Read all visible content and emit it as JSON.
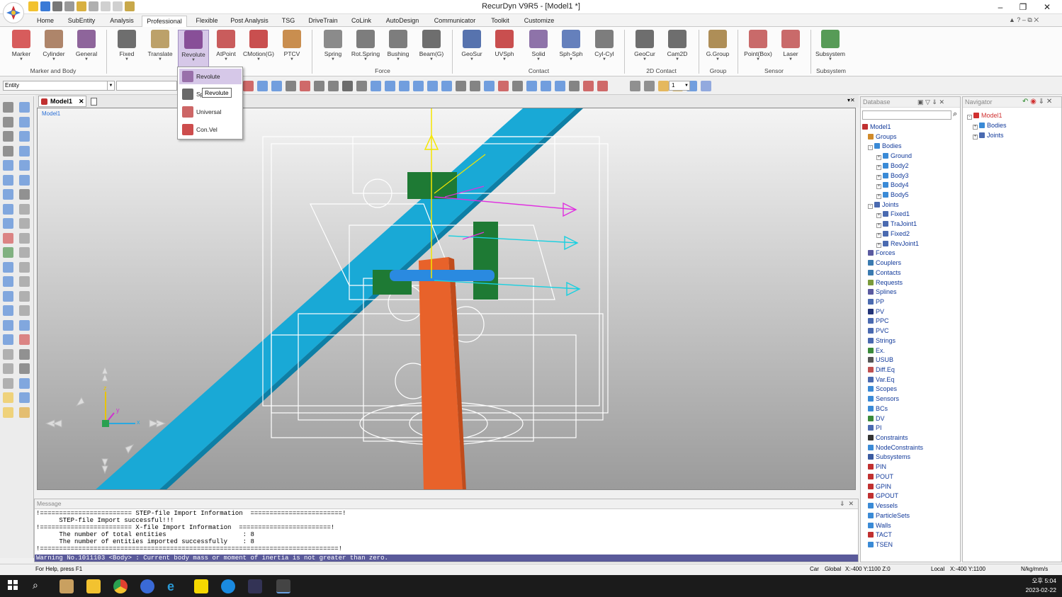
{
  "window": {
    "title": "RecurDyn V9R5  - [Model1 *]"
  },
  "tabs": [
    "Home",
    "SubEntity",
    "Analysis",
    "Professional",
    "Flexible",
    "Post Analysis",
    "TSG",
    "DriveTrain",
    "CoLink",
    "AutoDesign",
    "Communicator",
    "Toolkit",
    "Customize"
  ],
  "active_tab": "Professional",
  "ribbon": {
    "buttons": [
      "Marker",
      "Cylinder",
      "General",
      "Fixed",
      "Translate",
      "Revolute",
      "AtPoint",
      "CMotion(G)",
      "PTCV",
      "Spring",
      "Rot.Spring",
      "Bushing",
      "Beam(G)",
      "GeoSur",
      "UVSph",
      "Solid",
      "Sph-Sph",
      "Cyl-Cyl",
      "GeoCur",
      "Cam2D",
      "G.Group",
      "Point(Box)",
      "Laser",
      "Subsystem"
    ],
    "groups": [
      "Marker and Body",
      "Force",
      "Contact",
      "2D Contact",
      "Group",
      "Sensor",
      "Subsystem"
    ]
  },
  "entity_combo": "Entity",
  "toolbar_number": "1",
  "document_tab": "Model1",
  "viewport_label": "Model1",
  "axis_labels": {
    "z": "z",
    "y": "y",
    "x": "x"
  },
  "revolute_dropdown": {
    "items": [
      "Revolute",
      "Sp",
      "Universal",
      "Con.Vel"
    ],
    "tooltip": "Revolute"
  },
  "database": {
    "title": "Database",
    "tree": [
      {
        "label": "Model1",
        "level": 0,
        "color": "#c03030"
      },
      {
        "label": "Groups",
        "level": 1,
        "color": "#d08a2a"
      },
      {
        "label": "Bodies",
        "level": 1,
        "color": "#3a8ad6",
        "exp": "-"
      },
      {
        "label": "Ground",
        "level": 2,
        "color": "#3a8ad6",
        "exp": "+"
      },
      {
        "label": "Body2",
        "level": 2,
        "color": "#3a8ad6",
        "exp": "+"
      },
      {
        "label": "Body3",
        "level": 2,
        "color": "#3a8ad6",
        "exp": "+"
      },
      {
        "label": "Body4",
        "level": 2,
        "color": "#3a8ad6",
        "exp": "+"
      },
      {
        "label": "Body5",
        "level": 2,
        "color": "#3a8ad6",
        "exp": "+"
      },
      {
        "label": "Joints",
        "level": 1,
        "color": "#4a6ab0",
        "exp": "-"
      },
      {
        "label": "Fixed1",
        "level": 2,
        "color": "#4a6ab0",
        "exp": "+"
      },
      {
        "label": "TraJoint1",
        "level": 2,
        "color": "#4a6ab0",
        "exp": "+"
      },
      {
        "label": "Fixed2",
        "level": 2,
        "color": "#4a6ab0",
        "exp": "+"
      },
      {
        "label": "RevJoint1",
        "level": 2,
        "color": "#4a6ab0",
        "exp": "+"
      },
      {
        "label": "Forces",
        "level": 1,
        "color": "#5a5aa0"
      },
      {
        "label": "Couplers",
        "level": 1,
        "color": "#3a7ab0"
      },
      {
        "label": "Contacts",
        "level": 1,
        "color": "#3a7ab0"
      },
      {
        "label": "Requests",
        "level": 1,
        "color": "#7a9a3a"
      },
      {
        "label": "Splines",
        "level": 1,
        "color": "#5a5aa0"
      },
      {
        "label": "PP",
        "level": 1,
        "color": "#4a6ab0"
      },
      {
        "label": "PV",
        "level": 1,
        "color": "#223377"
      },
      {
        "label": "PPC",
        "level": 1,
        "color": "#4a6ab0"
      },
      {
        "label": "PVC",
        "level": 1,
        "color": "#4a6ab0"
      },
      {
        "label": "Strings",
        "level": 1,
        "color": "#4a6ab0"
      },
      {
        "label": "Ex.",
        "level": 1,
        "color": "#3a8a3a"
      },
      {
        "label": "USUB",
        "level": 1,
        "color": "#555555"
      },
      {
        "label": "Diff.Eq",
        "level": 1,
        "color": "#c05050"
      },
      {
        "label": "Var.Eq",
        "level": 1,
        "color": "#4a6ab0"
      },
      {
        "label": "Scopes",
        "level": 1,
        "color": "#3a8ad6"
      },
      {
        "label": "Sensors",
        "level": 1,
        "color": "#3a8ad6"
      },
      {
        "label": "BCs",
        "level": 1,
        "color": "#3a8ad6"
      },
      {
        "label": "DV",
        "level": 1,
        "color": "#3a8a3a"
      },
      {
        "label": "PI",
        "level": 1,
        "color": "#4a6ab0"
      },
      {
        "label": "Constraints",
        "level": 1,
        "color": "#333333"
      },
      {
        "label": "NodeConstraints",
        "level": 1,
        "color": "#3a8ad6"
      },
      {
        "label": "Subsystems",
        "level": 1,
        "color": "#3a5aa0"
      },
      {
        "label": "PIN",
        "level": 1,
        "color": "#c03030"
      },
      {
        "label": "POUT",
        "level": 1,
        "color": "#c03030"
      },
      {
        "label": "GPIN",
        "level": 1,
        "color": "#c03030"
      },
      {
        "label": "GPOUT",
        "level": 1,
        "color": "#c03030"
      },
      {
        "label": "Vessels",
        "level": 1,
        "color": "#3a8ad6"
      },
      {
        "label": "ParticleSets",
        "level": 1,
        "color": "#3a8ad6"
      },
      {
        "label": "Walls",
        "level": 1,
        "color": "#3a8ad6"
      },
      {
        "label": "TACT",
        "level": 1,
        "color": "#c03030"
      },
      {
        "label": "TSEN",
        "level": 1,
        "color": "#3a8ad6"
      }
    ]
  },
  "navigator": {
    "title": "Navigator",
    "tree": [
      {
        "label": "Model1",
        "level": 0,
        "color": "#d03030",
        "exp": "-"
      },
      {
        "label": "Bodies",
        "level": 1,
        "color": "#3a8ad6",
        "exp": "+"
      },
      {
        "label": "Joints",
        "level": 1,
        "color": "#4a6ab0",
        "exp": "+"
      }
    ]
  },
  "message": {
    "title": "Message",
    "lines": [
      "!======================== STEP-file Import Information  ========================!",
      "      STEP-file Import successful!!!",
      "!======================== X-file Import Information  ========================!",
      "      The number of total entities                    : 8",
      "      The number of entities imported successfully    : 8",
      "!==============================================================================!"
    ],
    "warning": "Warning No.1011103 <Body> : Current body mass or moment of inertia is not greater than zero."
  },
  "status": {
    "help": "For Help, press F1",
    "car": "Car",
    "global": "Global",
    "global_coord": "X:-400 Y:1100 Z:0",
    "local": "Local",
    "local_coord": "X:-400 Y:1100",
    "units": "N/kg/mm/s"
  },
  "taskbar": {
    "time": "오후 5:04",
    "date": "2023-02-22"
  }
}
